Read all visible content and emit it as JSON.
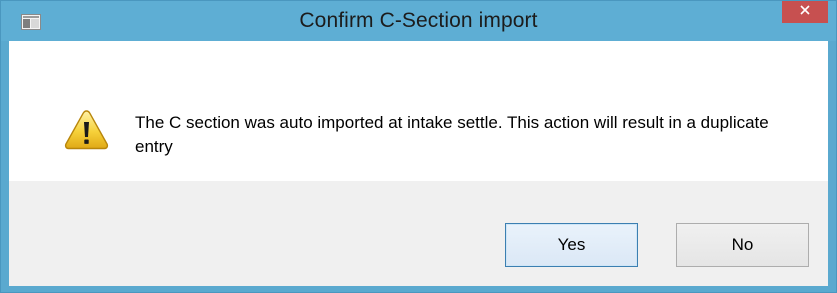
{
  "dialog": {
    "title": "Confirm C-Section import",
    "message": "The C section was auto imported at intake settle. This action will result in a duplicate entry",
    "buttons": {
      "yes_label": "Yes",
      "no_label": "No"
    },
    "icons": {
      "app": "window-icon",
      "close": "close-icon",
      "message": "warning-icon"
    },
    "colors": {
      "titlebar": "#5eaed4",
      "close_button": "#c75050",
      "button_area": "#f0f0f0",
      "default_button_border": "#3c7fb1"
    }
  }
}
